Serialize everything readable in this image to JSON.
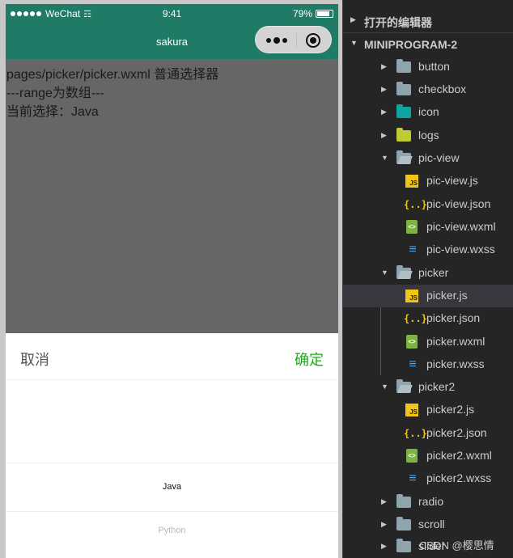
{
  "phone": {
    "status": {
      "carrier": "WeChat",
      "time": "9:41",
      "battery": "79%"
    },
    "nav_title": "sakura",
    "content": {
      "line1": "pages/picker/picker.wxml 普通选择器",
      "line2": "---range为数组---",
      "line3": "当前选择：Java"
    },
    "picker": {
      "cancel_label": "取消",
      "confirm_label": "确定",
      "options": [
        "Java",
        "Python"
      ],
      "selected_index": 0
    }
  },
  "explorer": {
    "open_editors_label": "打开的编辑器",
    "project_label": "MINIPROGRAM-2",
    "items": [
      {
        "label": "button",
        "type": "folder",
        "expanded": false
      },
      {
        "label": "checkbox",
        "type": "folder",
        "expanded": false
      },
      {
        "label": "icon",
        "type": "folder",
        "expanded": false
      },
      {
        "label": "logs",
        "type": "folder",
        "expanded": false
      },
      {
        "label": "pic-view",
        "type": "folder",
        "expanded": true
      },
      {
        "label": "pic-view.js",
        "type": "js"
      },
      {
        "label": "pic-view.json",
        "type": "json"
      },
      {
        "label": "pic-view.wxml",
        "type": "wxml"
      },
      {
        "label": "pic-view.wxss",
        "type": "wxss"
      },
      {
        "label": "picker",
        "type": "folder",
        "expanded": true
      },
      {
        "label": "picker.js",
        "type": "js",
        "selected": true
      },
      {
        "label": "picker.json",
        "type": "json"
      },
      {
        "label": "picker.wxml",
        "type": "wxml"
      },
      {
        "label": "picker.wxss",
        "type": "wxss"
      },
      {
        "label": "picker2",
        "type": "folder",
        "expanded": true
      },
      {
        "label": "picker2.js",
        "type": "js"
      },
      {
        "label": "picker2.json",
        "type": "json"
      },
      {
        "label": "picker2.wxml",
        "type": "wxml"
      },
      {
        "label": "picker2.wxss",
        "type": "wxss"
      },
      {
        "label": "radio",
        "type": "folder",
        "expanded": false
      },
      {
        "label": "scroll",
        "type": "folder",
        "expanded": false
      },
      {
        "label": "slider",
        "type": "folder",
        "expanded": false
      }
    ]
  },
  "watermark": "CSDN @樱思情",
  "colors": {
    "nav_bar": "#1f7a66",
    "confirm": "#1aad19",
    "explorer_bg": "#252526",
    "selected_row": "#37373d"
  }
}
